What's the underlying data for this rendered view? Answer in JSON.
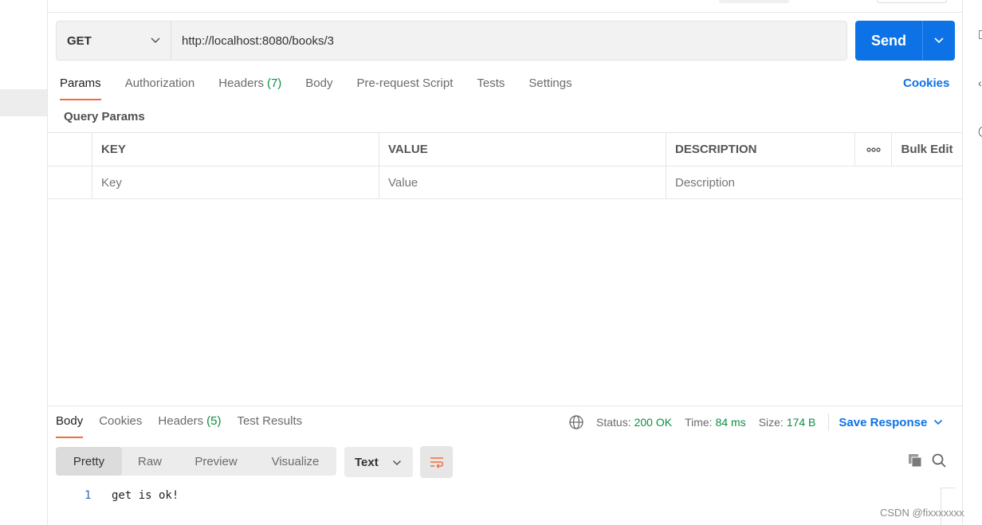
{
  "request": {
    "method": "GET",
    "url": "http://localhost:8080/books/3",
    "send_label": "Send"
  },
  "request_tabs": [
    {
      "label": "Params",
      "count": ""
    },
    {
      "label": "Authorization",
      "count": ""
    },
    {
      "label": "Headers",
      "count": "(7)"
    },
    {
      "label": "Body",
      "count": ""
    },
    {
      "label": "Pre-request Script",
      "count": ""
    },
    {
      "label": "Tests",
      "count": ""
    },
    {
      "label": "Settings",
      "count": ""
    }
  ],
  "cookies_label": "Cookies",
  "query_params": {
    "section_label": "Query Params",
    "columns": {
      "key": "KEY",
      "value": "VALUE",
      "description": "DESCRIPTION"
    },
    "bulk_edit_label": "Bulk Edit",
    "placeholders": {
      "key": "Key",
      "value": "Value",
      "description": "Description"
    }
  },
  "response_tabs": [
    {
      "label": "Body",
      "count": ""
    },
    {
      "label": "Cookies",
      "count": ""
    },
    {
      "label": "Headers",
      "count": "(5)"
    },
    {
      "label": "Test Results",
      "count": ""
    }
  ],
  "status": {
    "status_label": "Status:",
    "status_value": "200 OK",
    "time_label": "Time:",
    "time_value": "84 ms",
    "size_label": "Size:",
    "size_value": "174 B",
    "save_response_label": "Save Response"
  },
  "view_modes": [
    "Pretty",
    "Raw",
    "Preview",
    "Visualize"
  ],
  "format": "Text",
  "response_body": [
    {
      "line": "1",
      "text": "get is ok!"
    }
  ],
  "watermark": "CSDN @fixxxxxxx",
  "colors": {
    "accent": "#0d72e6",
    "active_tab": "#f26b3a",
    "success": "#0a8f3e"
  },
  "icons": [
    "chevron-down-icon",
    "globe-icon",
    "wrap-lines-icon",
    "copy-icon",
    "search-icon",
    "more-icon"
  ]
}
